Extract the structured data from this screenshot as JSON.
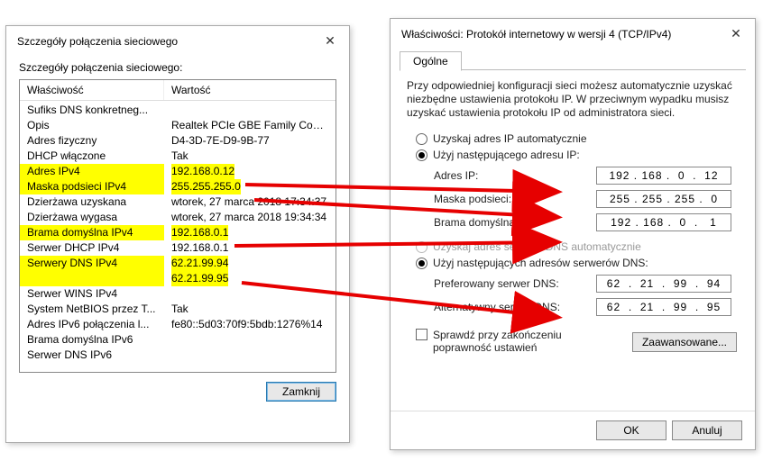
{
  "left": {
    "title": "Szczegóły połączenia sieciowego",
    "sub": "Szczegóły połączenia sieciowego:",
    "col_prop": "Właściwość",
    "col_val": "Wartość",
    "rows": [
      {
        "p": "Sufiks DNS konkretneg...",
        "v": ""
      },
      {
        "p": "Opis",
        "v": "Realtek PCIe GBE Family Controller"
      },
      {
        "p": "Adres fizyczny",
        "v": "D4-3D-7E-D9-9B-77"
      },
      {
        "p": "DHCP włączone",
        "v": "Tak"
      },
      {
        "p": "Adres IPv4",
        "v": "192.168.0.12"
      },
      {
        "p": "Maska podsieci IPv4",
        "v": "255.255.255.0"
      },
      {
        "p": "Dzierżawa uzyskana",
        "v": "wtorek, 27 marca 2018 17:34:37"
      },
      {
        "p": "Dzierżawa wygasa",
        "v": "wtorek, 27 marca 2018 19:34:34"
      },
      {
        "p": "Brama domyślna IPv4",
        "v": "192.168.0.1"
      },
      {
        "p": "Serwer DHCP IPv4",
        "v": "192.168.0.1"
      },
      {
        "p": "Serwery DNS IPv4",
        "v": "62.21.99.94"
      },
      {
        "p": "",
        "v": "62.21.99.95"
      },
      {
        "p": "Serwer WINS IPv4",
        "v": ""
      },
      {
        "p": "System NetBIOS przez T...",
        "v": "Tak"
      },
      {
        "p": "Adres IPv6 połączenia l...",
        "v": "fe80::5d03:70f9:5bdb:1276%14"
      },
      {
        "p": "Brama domyślna IPv6",
        "v": ""
      },
      {
        "p": "Serwer DNS IPv6",
        "v": ""
      }
    ],
    "highlights": [
      4,
      5,
      8,
      10,
      11
    ],
    "close_btn": "Zamknij"
  },
  "right": {
    "title": "Właściwości: Protokół internetowy w wersji 4 (TCP/IPv4)",
    "tab": "Ogólne",
    "desc": "Przy odpowiedniej konfiguracji sieci możesz automatycznie uzyskać niezbędne ustawienia protokołu IP. W przeciwnym wypadku musisz uzyskać ustawienia protokołu IP od administratora sieci.",
    "radio_ip_auto": "Uzyskaj adres IP automatycznie",
    "radio_ip_manual": "Użyj następującego adresu IP:",
    "f_ip": "Adres IP:",
    "f_mask": "Maska podsieci:",
    "f_gw": "Brama domyślna:",
    "v_ip": "192 . 168 .  0  .  12",
    "v_mask": "255 . 255 . 255 .  0",
    "v_gw": "192 . 168 .  0  .   1",
    "radio_dns_auto": "Uzyskaj adres serwera DNS automatycznie",
    "radio_dns_manual": "Użyj następujących adresów serwerów DNS:",
    "f_dns1": "Preferowany serwer DNS:",
    "f_dns2": "Alternatywny serwer DNS:",
    "v_dns1": "62  .  21  .  99  .  94",
    "v_dns2": "62  .  21  .  99  .  95",
    "check_validate": "Sprawdź przy zakończeniu poprawność ustawień",
    "btn_adv": "Zaawansowane...",
    "btn_ok": "OK",
    "btn_cancel": "Anuluj"
  }
}
